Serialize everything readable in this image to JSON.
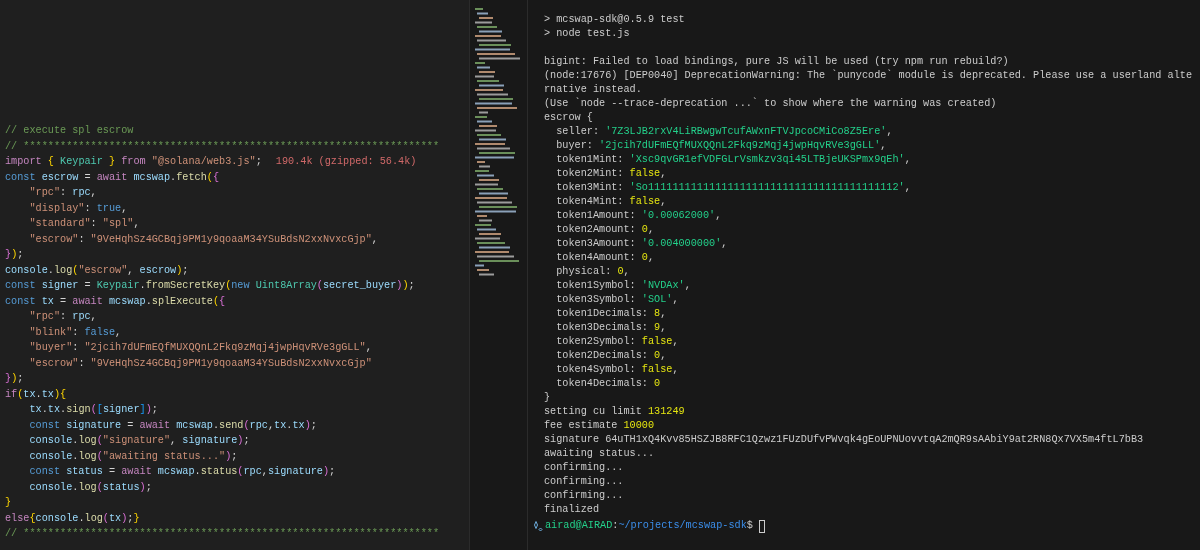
{
  "editor": {
    "lines": [
      [
        {
          "kind": "comment",
          "text": "// execute spl escrow"
        }
      ],
      [
        {
          "kind": "comment",
          "text": "// ********************************************************************"
        }
      ],
      [
        {
          "kind": "control",
          "text": "import "
        },
        {
          "kind": "bracket1",
          "text": "{"
        },
        {
          "kind": "class",
          "text": " Keypair "
        },
        {
          "kind": "bracket1",
          "text": "}"
        },
        {
          "kind": "control",
          "text": " from "
        },
        {
          "kind": "string",
          "text": "\"@solana/web3.js\""
        },
        {
          "kind": "plain",
          "text": ";"
        },
        {
          "kind": "annotation",
          "text": "190.4k (gzipped: 56.4k)"
        }
      ],
      [
        {
          "kind": "keyword",
          "text": "const "
        },
        {
          "kind": "var",
          "text": "escrow"
        },
        {
          "kind": "plain",
          "text": " = "
        },
        {
          "kind": "control",
          "text": "await "
        },
        {
          "kind": "var",
          "text": "mcswap"
        },
        {
          "kind": "plain",
          "text": "."
        },
        {
          "kind": "func",
          "text": "fetch"
        },
        {
          "kind": "bracket1",
          "text": "("
        },
        {
          "kind": "bracket2",
          "text": "{"
        }
      ],
      [
        {
          "kind": "string",
          "text": "    \"rpc\""
        },
        {
          "kind": "plain",
          "text": ": "
        },
        {
          "kind": "var",
          "text": "rpc"
        },
        {
          "kind": "plain",
          "text": ","
        }
      ],
      [
        {
          "kind": "string",
          "text": "    \"display\""
        },
        {
          "kind": "plain",
          "text": ": "
        },
        {
          "kind": "bool",
          "text": "true"
        },
        {
          "kind": "plain",
          "text": ","
        }
      ],
      [
        {
          "kind": "string",
          "text": "    \"standard\""
        },
        {
          "kind": "plain",
          "text": ": "
        },
        {
          "kind": "string",
          "text": "\"spl\""
        },
        {
          "kind": "plain",
          "text": ","
        }
      ],
      [
        {
          "kind": "string",
          "text": "    \"escrow\""
        },
        {
          "kind": "plain",
          "text": ": "
        },
        {
          "kind": "string",
          "text": "\"9VeHqhSz4GCBqj9PM1y9qoaaM34YSuBdsN2xxNvxcGjp\""
        },
        {
          "kind": "plain",
          "text": ","
        }
      ],
      [
        {
          "kind": "bracket2",
          "text": "}"
        },
        {
          "kind": "bracket1",
          "text": ")"
        },
        {
          "kind": "plain",
          "text": ";"
        }
      ],
      [
        {
          "kind": "var",
          "text": "console"
        },
        {
          "kind": "plain",
          "text": "."
        },
        {
          "kind": "func",
          "text": "log"
        },
        {
          "kind": "bracket1",
          "text": "("
        },
        {
          "kind": "string",
          "text": "\"escrow\""
        },
        {
          "kind": "plain",
          "text": ", "
        },
        {
          "kind": "var",
          "text": "escrow"
        },
        {
          "kind": "bracket1",
          "text": ")"
        },
        {
          "kind": "plain",
          "text": ";"
        }
      ],
      [
        {
          "kind": "keyword",
          "text": "const "
        },
        {
          "kind": "var",
          "text": "signer"
        },
        {
          "kind": "plain",
          "text": " = "
        },
        {
          "kind": "class",
          "text": "Keypair"
        },
        {
          "kind": "plain",
          "text": "."
        },
        {
          "kind": "func",
          "text": "fromSecretKey"
        },
        {
          "kind": "bracket1",
          "text": "("
        },
        {
          "kind": "keyword",
          "text": "new "
        },
        {
          "kind": "class",
          "text": "Uint8Array"
        },
        {
          "kind": "bracket2",
          "text": "("
        },
        {
          "kind": "var",
          "text": "secret_buyer"
        },
        {
          "kind": "bracket2",
          "text": ")"
        },
        {
          "kind": "bracket1",
          "text": ")"
        },
        {
          "kind": "plain",
          "text": ";"
        }
      ],
      [
        {
          "kind": "keyword",
          "text": "const "
        },
        {
          "kind": "var",
          "text": "tx"
        },
        {
          "kind": "plain",
          "text": " = "
        },
        {
          "kind": "control",
          "text": "await "
        },
        {
          "kind": "var",
          "text": "mcswap"
        },
        {
          "kind": "plain",
          "text": "."
        },
        {
          "kind": "func",
          "text": "splExecute"
        },
        {
          "kind": "bracket1",
          "text": "("
        },
        {
          "kind": "bracket2",
          "text": "{"
        }
      ],
      [
        {
          "kind": "string",
          "text": "    \"rpc\""
        },
        {
          "kind": "plain",
          "text": ": "
        },
        {
          "kind": "var",
          "text": "rpc"
        },
        {
          "kind": "plain",
          "text": ","
        }
      ],
      [
        {
          "kind": "string",
          "text": "    \"blink\""
        },
        {
          "kind": "plain",
          "text": ": "
        },
        {
          "kind": "bool",
          "text": "false"
        },
        {
          "kind": "plain",
          "text": ","
        }
      ],
      [
        {
          "kind": "string",
          "text": "    \"buyer\""
        },
        {
          "kind": "plain",
          "text": ": "
        },
        {
          "kind": "string",
          "text": "\"2jcih7dUFmEQfMUXQQnL2Fkq9zMqj4jwpHqvRVe3gGLL\""
        },
        {
          "kind": "plain",
          "text": ","
        }
      ],
      [
        {
          "kind": "string",
          "text": "    \"escrow\""
        },
        {
          "kind": "plain",
          "text": ": "
        },
        {
          "kind": "string",
          "text": "\"9VeHqhSz4GCBqj9PM1y9qoaaM34YSuBdsN2xxNvxcGjp\""
        }
      ],
      [
        {
          "kind": "bracket2",
          "text": "}"
        },
        {
          "kind": "bracket1",
          "text": ")"
        },
        {
          "kind": "plain",
          "text": ";"
        }
      ],
      [
        {
          "kind": "control",
          "text": "if"
        },
        {
          "kind": "bracket1",
          "text": "("
        },
        {
          "kind": "var",
          "text": "tx"
        },
        {
          "kind": "plain",
          "text": "."
        },
        {
          "kind": "var",
          "text": "tx"
        },
        {
          "kind": "bracket1",
          "text": ")"
        },
        {
          "kind": "bracket1",
          "text": "{"
        }
      ],
      [
        {
          "kind": "var",
          "text": "    tx"
        },
        {
          "kind": "plain",
          "text": "."
        },
        {
          "kind": "var",
          "text": "tx"
        },
        {
          "kind": "plain",
          "text": "."
        },
        {
          "kind": "func",
          "text": "sign"
        },
        {
          "kind": "bracket2",
          "text": "("
        },
        {
          "kind": "bracket3",
          "text": "["
        },
        {
          "kind": "var",
          "text": "signer"
        },
        {
          "kind": "bracket3",
          "text": "]"
        },
        {
          "kind": "bracket2",
          "text": ")"
        },
        {
          "kind": "plain",
          "text": ";"
        }
      ],
      [
        {
          "kind": "keyword",
          "text": "    const "
        },
        {
          "kind": "var",
          "text": "signature"
        },
        {
          "kind": "plain",
          "text": " = "
        },
        {
          "kind": "control",
          "text": "await "
        },
        {
          "kind": "var",
          "text": "mcswap"
        },
        {
          "kind": "plain",
          "text": "."
        },
        {
          "kind": "func",
          "text": "send"
        },
        {
          "kind": "bracket2",
          "text": "("
        },
        {
          "kind": "var",
          "text": "rpc"
        },
        {
          "kind": "plain",
          "text": ","
        },
        {
          "kind": "var",
          "text": "tx"
        },
        {
          "kind": "plain",
          "text": "."
        },
        {
          "kind": "var",
          "text": "tx"
        },
        {
          "kind": "bracket2",
          "text": ")"
        },
        {
          "kind": "plain",
          "text": ";"
        }
      ],
      [
        {
          "kind": "var",
          "text": "    console"
        },
        {
          "kind": "plain",
          "text": "."
        },
        {
          "kind": "func",
          "text": "log"
        },
        {
          "kind": "bracket2",
          "text": "("
        },
        {
          "kind": "string",
          "text": "\"signature\""
        },
        {
          "kind": "plain",
          "text": ", "
        },
        {
          "kind": "var",
          "text": "signature"
        },
        {
          "kind": "bracket2",
          "text": ")"
        },
        {
          "kind": "plain",
          "text": ";"
        }
      ],
      [
        {
          "kind": "var",
          "text": "    console"
        },
        {
          "kind": "plain",
          "text": "."
        },
        {
          "kind": "func",
          "text": "log"
        },
        {
          "kind": "bracket2",
          "text": "("
        },
        {
          "kind": "string",
          "text": "\"awaiting status...\""
        },
        {
          "kind": "bracket2",
          "text": ")"
        },
        {
          "kind": "plain",
          "text": ";"
        }
      ],
      [
        {
          "kind": "keyword",
          "text": "    const "
        },
        {
          "kind": "var",
          "text": "status"
        },
        {
          "kind": "plain",
          "text": " = "
        },
        {
          "kind": "control",
          "text": "await "
        },
        {
          "kind": "var",
          "text": "mcswap"
        },
        {
          "kind": "plain",
          "text": "."
        },
        {
          "kind": "func",
          "text": "status"
        },
        {
          "kind": "bracket2",
          "text": "("
        },
        {
          "kind": "var",
          "text": "rpc"
        },
        {
          "kind": "plain",
          "text": ","
        },
        {
          "kind": "var",
          "text": "signature"
        },
        {
          "kind": "bracket2",
          "text": ")"
        },
        {
          "kind": "plain",
          "text": ";"
        }
      ],
      [
        {
          "kind": "var",
          "text": "    console"
        },
        {
          "kind": "plain",
          "text": "."
        },
        {
          "kind": "func",
          "text": "log"
        },
        {
          "kind": "bracket2",
          "text": "("
        },
        {
          "kind": "var",
          "text": "status"
        },
        {
          "kind": "bracket2",
          "text": ")"
        },
        {
          "kind": "plain",
          "text": ";"
        }
      ],
      [
        {
          "kind": "bracket1",
          "text": "}"
        }
      ],
      [
        {
          "kind": "control",
          "text": "else"
        },
        {
          "kind": "bracket1",
          "text": "{"
        },
        {
          "kind": "var",
          "text": "console"
        },
        {
          "kind": "plain",
          "text": "."
        },
        {
          "kind": "func",
          "text": "log"
        },
        {
          "kind": "bracket2",
          "text": "("
        },
        {
          "kind": "var",
          "text": "tx"
        },
        {
          "kind": "bracket2",
          "text": ")"
        },
        {
          "kind": "plain",
          "text": ";"
        },
        {
          "kind": "bracket1",
          "text": "}"
        }
      ],
      [
        {
          "kind": "comment",
          "text": "// ********************************************************************"
        }
      ]
    ]
  },
  "terminal": {
    "blocks": [
      {
        "lines": [
          [
            {
              "kind": "plain",
              "text": "> mcswap-sdk@0.5.9 test"
            }
          ],
          [
            {
              "kind": "plain",
              "text": "> node test.js"
            }
          ]
        ]
      },
      {
        "lines": [
          [
            {
              "kind": "plain",
              "text": "bigint: Failed to load bindings, pure JS will be used (try npm run rebuild?)"
            }
          ],
          [
            {
              "kind": "plain",
              "text": "(node:17676) [DEP0040] DeprecationWarning: The `punycode` module is deprecated. Please use a userland alte"
            }
          ],
          [
            {
              "kind": "plain",
              "text": "rnative instead."
            }
          ],
          [
            {
              "kind": "plain",
              "text": "(Use `node --trace-deprecation ...` to show where the warning was created)"
            }
          ],
          [
            {
              "kind": "plain",
              "text": "escrow {"
            }
          ],
          [
            {
              "kind": "plain",
              "text": "  seller: "
            },
            {
              "kind": "string",
              "text": "'7Z3LJB2rxV4LiRBwgwTcufAWxnFTVJpcoCMiCo8Z5Ere'"
            },
            {
              "kind": "plain",
              "text": ","
            }
          ],
          [
            {
              "kind": "plain",
              "text": "  buyer: "
            },
            {
              "kind": "string",
              "text": "'2jcih7dUFmEQfMUXQQnL2Fkq9zMqj4jwpHqvRVe3gGLL'"
            },
            {
              "kind": "plain",
              "text": ","
            }
          ],
          [
            {
              "kind": "plain",
              "text": "  token1Mint: "
            },
            {
              "kind": "string",
              "text": "'Xsc9qvGR1efVDFGLrVsmkzv3qi45LTBjeUKSPmx9qEh'"
            },
            {
              "kind": "plain",
              "text": ","
            }
          ],
          [
            {
              "kind": "plain",
              "text": "  token2Mint: "
            },
            {
              "kind": "number",
              "text": "false"
            },
            {
              "kind": "plain",
              "text": ","
            }
          ],
          [
            {
              "kind": "plain",
              "text": "  token3Mint: "
            },
            {
              "kind": "string",
              "text": "'So11111111111111111111111111111111111111112'"
            },
            {
              "kind": "plain",
              "text": ","
            }
          ],
          [
            {
              "kind": "plain",
              "text": "  token4Mint: "
            },
            {
              "kind": "number",
              "text": "false"
            },
            {
              "kind": "plain",
              "text": ","
            }
          ],
          [
            {
              "kind": "plain",
              "text": "  token1Amount: "
            },
            {
              "kind": "string",
              "text": "'0.00062000'"
            },
            {
              "kind": "plain",
              "text": ","
            }
          ],
          [
            {
              "kind": "plain",
              "text": "  token2Amount: "
            },
            {
              "kind": "number",
              "text": "0"
            },
            {
              "kind": "plain",
              "text": ","
            }
          ],
          [
            {
              "kind": "plain",
              "text": "  token3Amount: "
            },
            {
              "kind": "string",
              "text": "'0.004000000'"
            },
            {
              "kind": "plain",
              "text": ","
            }
          ],
          [
            {
              "kind": "plain",
              "text": "  token4Amount: "
            },
            {
              "kind": "number",
              "text": "0"
            },
            {
              "kind": "plain",
              "text": ","
            }
          ],
          [
            {
              "kind": "plain",
              "text": "  physical: "
            },
            {
              "kind": "number",
              "text": "0"
            },
            {
              "kind": "plain",
              "text": ","
            }
          ],
          [
            {
              "kind": "plain",
              "text": "  token1Symbol: "
            },
            {
              "kind": "string",
              "text": "'NVDAx'"
            },
            {
              "kind": "plain",
              "text": ","
            }
          ],
          [
            {
              "kind": "plain",
              "text": "  token3Symbol: "
            },
            {
              "kind": "string",
              "text": "'SOL'"
            },
            {
              "kind": "plain",
              "text": ","
            }
          ],
          [
            {
              "kind": "plain",
              "text": "  token1Decimals: "
            },
            {
              "kind": "number",
              "text": "8"
            },
            {
              "kind": "plain",
              "text": ","
            }
          ],
          [
            {
              "kind": "plain",
              "text": "  token3Decimals: "
            },
            {
              "kind": "number",
              "text": "9"
            },
            {
              "kind": "plain",
              "text": ","
            }
          ],
          [
            {
              "kind": "plain",
              "text": "  token2Symbol: "
            },
            {
              "kind": "number",
              "text": "false"
            },
            {
              "kind": "plain",
              "text": ","
            }
          ],
          [
            {
              "kind": "plain",
              "text": "  token2Decimals: "
            },
            {
              "kind": "number",
              "text": "0"
            },
            {
              "kind": "plain",
              "text": ","
            }
          ],
          [
            {
              "kind": "plain",
              "text": "  token4Symbol: "
            },
            {
              "kind": "number",
              "text": "false"
            },
            {
              "kind": "plain",
              "text": ","
            }
          ],
          [
            {
              "kind": "plain",
              "text": "  token4Decimals: "
            },
            {
              "kind": "number",
              "text": "0"
            }
          ],
          [
            {
              "kind": "plain",
              "text": "}"
            }
          ],
          [
            {
              "kind": "plain",
              "text": "setting cu limit "
            },
            {
              "kind": "number",
              "text": "131249"
            }
          ],
          [
            {
              "kind": "plain",
              "text": "fee estimate "
            },
            {
              "kind": "number",
              "text": "10000"
            }
          ],
          [
            {
              "kind": "plain",
              "text": "signature 64uTH1xQ4Kvv85HSZJB8RFC1Qzwz1FUzDUfvPWvqk4gEoUPNUovvtqA2mQR9sAAbiY9at2RN8Qx7VX5m4ftL7bB3"
            }
          ],
          [
            {
              "kind": "plain",
              "text": "awaiting status..."
            }
          ],
          [
            {
              "kind": "plain",
              "text": "confirming..."
            }
          ],
          [
            {
              "kind": "plain",
              "text": "confirming..."
            }
          ],
          [
            {
              "kind": "plain",
              "text": "confirming..."
            }
          ],
          [
            {
              "kind": "plain",
              "text": "finalized"
            }
          ]
        ]
      }
    ],
    "prompt": [
      {
        "kind": "user",
        "text": "airad@AIRAD"
      },
      {
        "kind": "plain",
        "text": ":"
      },
      {
        "kind": "path",
        "text": "~/projects/mcswap-sdk"
      },
      {
        "kind": "plain",
        "text": "$"
      }
    ]
  }
}
